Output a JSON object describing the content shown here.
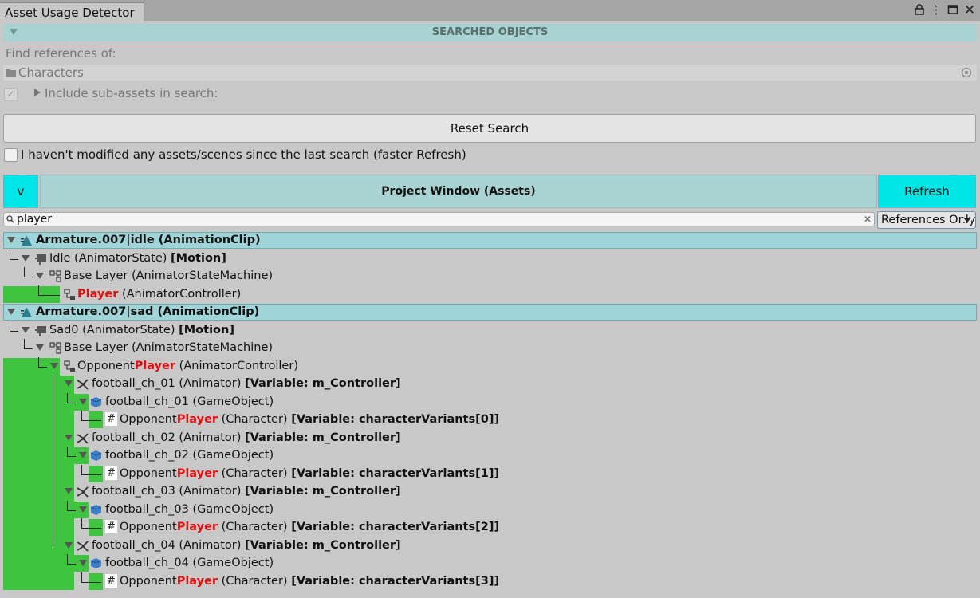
{
  "window": {
    "title": "Asset Usage Detector"
  },
  "searched_objects": {
    "header": "SEARCHED OBJECTS",
    "find_label": "Find references of:",
    "object_value": "Characters",
    "subassets_label": "Include sub-assets in search:"
  },
  "reset_label": "Reset Search",
  "no_modify_label": "I haven't modified any assets/scenes since the last search (faster Refresh)",
  "toolbar": {
    "collapse_label": "v",
    "title": "Project Window (Assets)",
    "refresh_label": "Refresh"
  },
  "search": {
    "value": "player",
    "dropdown": "References Only"
  },
  "results": [
    {
      "name": "Armature.007|idle",
      "type": "(AnimationClip)"
    },
    {
      "name": "Idle",
      "type": "(AnimatorState)",
      "extra": "[Motion]"
    },
    {
      "name": "Base Layer",
      "type": "(AnimatorStateMachine)"
    },
    {
      "name": "Player",
      "type": "(AnimatorController)"
    },
    {
      "name": "Armature.007|sad",
      "type": "(AnimationClip)"
    },
    {
      "name": "Sad0",
      "type": "(AnimatorState)",
      "extra": "[Motion]"
    },
    {
      "name": "Base Layer",
      "type": "(AnimatorStateMachine)"
    },
    {
      "prefix": "Opponent",
      "hl": "Player",
      "type": "(AnimatorController)"
    },
    {
      "name": "football_ch_01",
      "type": "(Animator)",
      "extra": "[Variable: m_Controller]"
    },
    {
      "name": "football_ch_01",
      "type": "(GameObject)"
    },
    {
      "prefix": "Opponent",
      "hl": "Player",
      "type": "(Character)",
      "extra": "[Variable: characterVariants[0]]"
    },
    {
      "name": "football_ch_02",
      "type": "(Animator)",
      "extra": "[Variable: m_Controller]"
    },
    {
      "name": "football_ch_02",
      "type": "(GameObject)"
    },
    {
      "prefix": "Opponent",
      "hl": "Player",
      "type": "(Character)",
      "extra": "[Variable: characterVariants[1]]"
    },
    {
      "name": "football_ch_03",
      "type": "(Animator)",
      "extra": "[Variable: m_Controller]"
    },
    {
      "name": "football_ch_03",
      "type": "(GameObject)"
    },
    {
      "prefix": "Opponent",
      "hl": "Player",
      "type": "(Character)",
      "extra": "[Variable: characterVariants[2]]"
    },
    {
      "name": "football_ch_04",
      "type": "(Animator)",
      "extra": "[Variable: m_Controller]"
    },
    {
      "name": "football_ch_04",
      "type": "(GameObject)"
    },
    {
      "prefix": "Opponent",
      "hl": "Player",
      "type": "(Character)",
      "extra": "[Variable: characterVariants[3]]"
    }
  ]
}
